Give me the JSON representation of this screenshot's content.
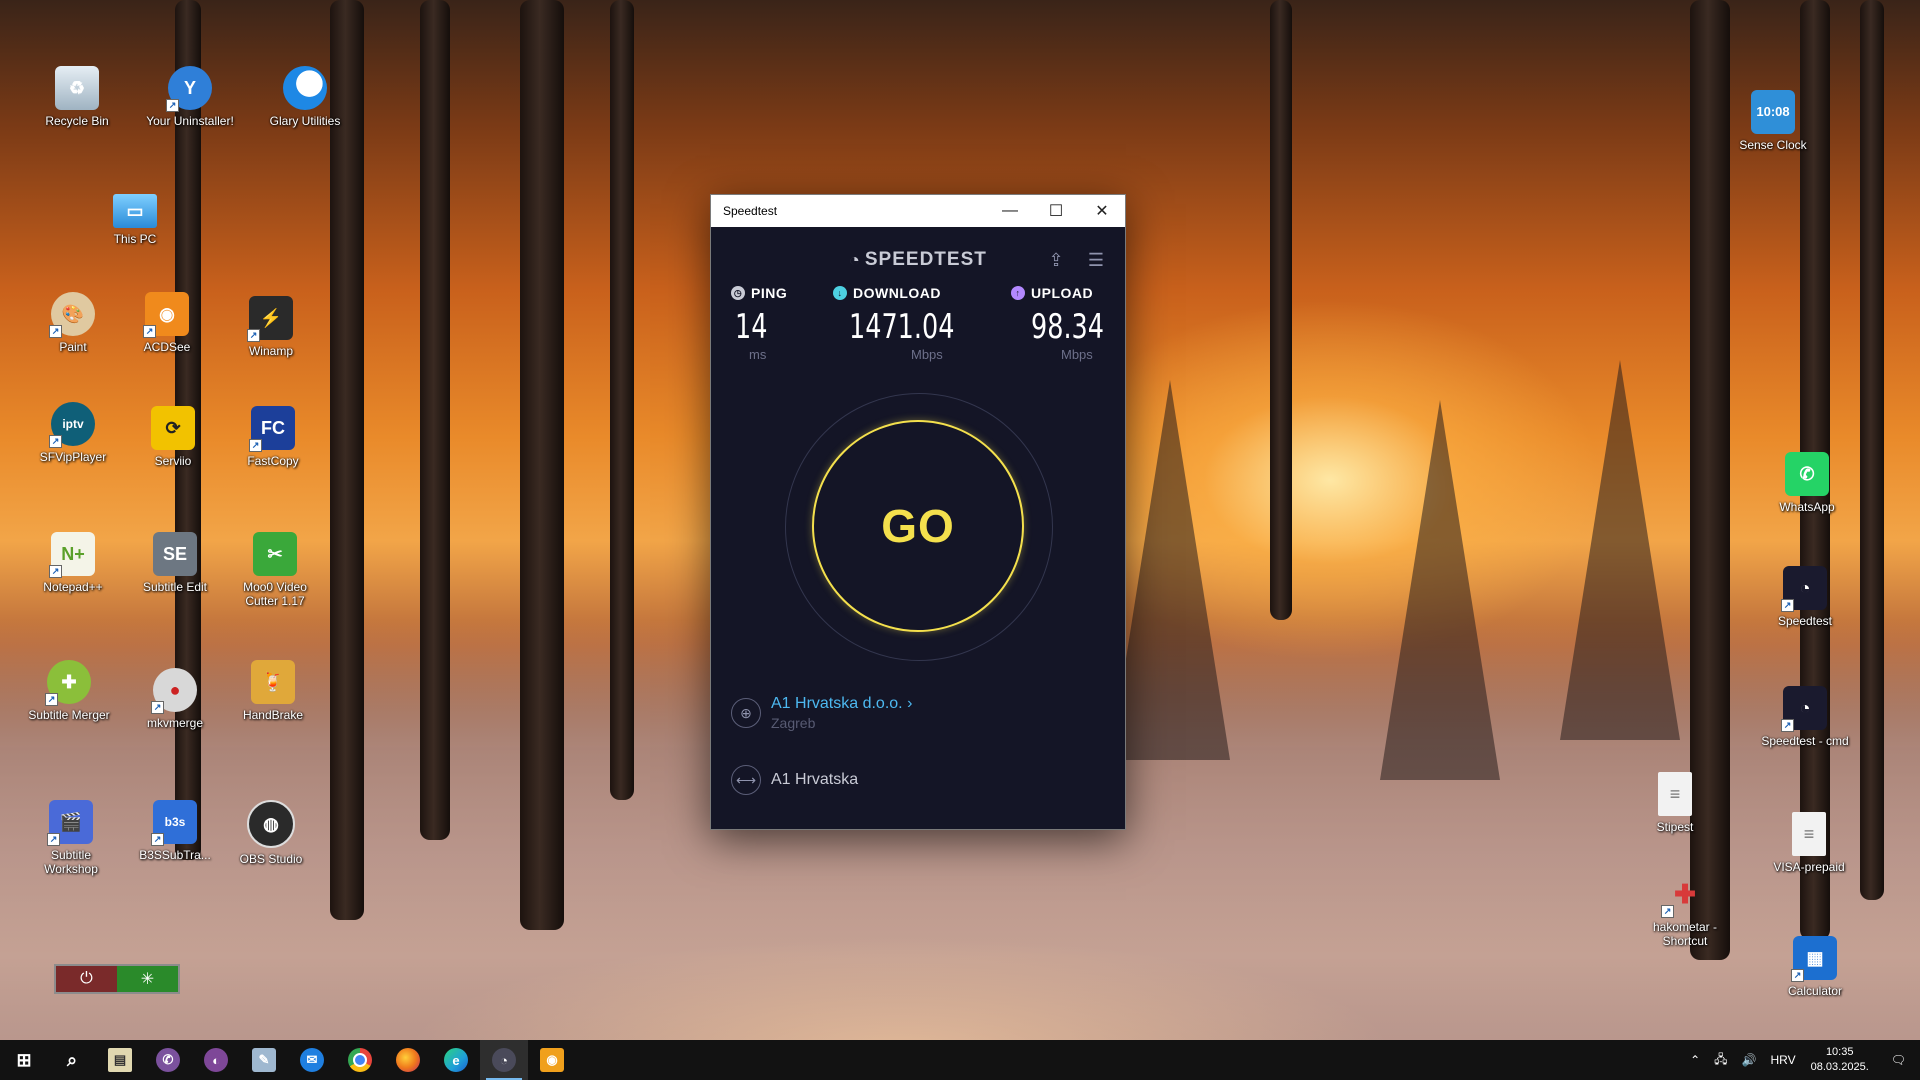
{
  "desktop_icons": [
    {
      "label": "Recycle Bin",
      "icon": "recycle-bin-icon",
      "color": "#c7d4de"
    },
    {
      "label": "Your Uninstaller!",
      "icon": "uninstaller-icon",
      "color": "#2f7fd8"
    },
    {
      "label": "Glary Utilities",
      "icon": "glary-utilities-icon",
      "color": "#1e88e5"
    },
    {
      "label": "This PC",
      "icon": "computer-icon",
      "color": "#3aa0e8"
    },
    {
      "label": "Paint",
      "icon": "paint-palette-icon",
      "color": "#e0c9a0"
    },
    {
      "label": "ACDSee",
      "icon": "acdsee-icon",
      "color": "#f08a1c"
    },
    {
      "label": "Winamp",
      "icon": "winamp-icon",
      "color": "#e8a21c"
    },
    {
      "label": "SFVipPlayer",
      "icon": "iptv-player-icon",
      "color": "#1b9bb8"
    },
    {
      "label": "Serviio",
      "icon": "serviio-icon",
      "color": "#f2c200"
    },
    {
      "label": "FastCopy",
      "icon": "fastcopy-icon",
      "color": "#1c3f9a"
    },
    {
      "label": "Notepad++",
      "icon": "notepad-plus-plus-icon",
      "color": "#7bbd3b"
    },
    {
      "label": "Subtitle Edit",
      "icon": "subtitle-edit-icon",
      "color": "#6d7782"
    },
    {
      "label": "Moo0 Video Cutter 1.17",
      "icon": "video-cutter-icon",
      "color": "#3aa83a"
    },
    {
      "label": "Subtitle Merger",
      "icon": "subtitle-merger-icon",
      "color": "#8bbf3a"
    },
    {
      "label": "mkvmerge",
      "icon": "mkvmerge-icon",
      "color": "#d8d8d8"
    },
    {
      "label": "HandBrake",
      "icon": "handbrake-icon",
      "color": "#e0a83a"
    },
    {
      "label": "Subtitle Workshop",
      "icon": "subtitle-workshop-icon",
      "color": "#4a6ad8"
    },
    {
      "label": "B3SSubTra...",
      "icon": "b3s-subtitle-icon",
      "color": "#2f6fd8"
    },
    {
      "label": "OBS Studio",
      "icon": "obs-studio-icon",
      "color": "#2a2a2a"
    },
    {
      "label": "Sense Clock",
      "icon": "sense-clock-icon",
      "color": "#2f8fd8"
    },
    {
      "label": "WhatsApp",
      "icon": "whatsapp-icon",
      "color": "#25d366"
    },
    {
      "label": "Speedtest",
      "icon": "speedtest-icon",
      "color": "#1a1a2e"
    },
    {
      "label": "Speedtest - cmd",
      "icon": "speedtest-cmd-icon",
      "color": "#1a1a2e"
    },
    {
      "label": "Stipest",
      "icon": "text-file-icon",
      "color": "#f2f2f2"
    },
    {
      "label": "VISA-prepaid",
      "icon": "text-file-icon",
      "color": "#f2f2f2"
    },
    {
      "label": "hakometar - Shortcut",
      "icon": "hakometar-icon",
      "color": "#d83a3a"
    },
    {
      "label": "Calculator",
      "icon": "calculator-icon",
      "color": "#1c6fd0"
    }
  ],
  "sense_clock_time": "10:08",
  "window": {
    "title": "Speedtest",
    "minimize": "—",
    "maximize": "☐",
    "close": "✕"
  },
  "speedtest": {
    "logo": "SPEEDTEST",
    "ping": {
      "label": "PING",
      "value": "14",
      "unit": "ms",
      "color": "#c9cbd6"
    },
    "download": {
      "label": "DOWNLOAD",
      "value": "1471.04",
      "unit": "Mbps",
      "color": "#4dd0e1"
    },
    "upload": {
      "label": "UPLOAD",
      "value": "98.34",
      "unit": "Mbps",
      "color": "#b388ff"
    },
    "go_label": "GO",
    "go_color": "#f4e04d",
    "isp": {
      "name": "A1 Hrvatska d.o.o.",
      "city": "Zagreb"
    },
    "host": "A1 Hrvatska"
  },
  "taskbar": {
    "items": [
      {
        "name": "start",
        "icon": "windows-start-icon",
        "color": "#ffffff"
      },
      {
        "name": "search",
        "icon": "search-icon",
        "color": "#ffffff"
      },
      {
        "name": "task-view",
        "icon": "task-view-icon",
        "color": "#e0d8b0"
      },
      {
        "name": "viber",
        "icon": "viber-icon",
        "color": "#7b519d"
      },
      {
        "name": "tor",
        "icon": "tor-browser-icon",
        "color": "#7e4798"
      },
      {
        "name": "notes",
        "icon": "notes-icon",
        "color": "#9fb8d0"
      },
      {
        "name": "thunderbird",
        "icon": "thunderbird-icon",
        "color": "#1f7fe0"
      },
      {
        "name": "chrome",
        "icon": "chrome-icon",
        "color": "#e8453c"
      },
      {
        "name": "firefox",
        "icon": "firefox-icon",
        "color": "#f07a1c"
      },
      {
        "name": "edge",
        "icon": "edge-icon",
        "color": "#1fa0d8"
      },
      {
        "name": "speedtest",
        "icon": "speedtest-icon",
        "color": "#4a4a5a"
      },
      {
        "name": "acdsee",
        "icon": "acdsee-icon",
        "color": "#f0a01c"
      }
    ],
    "language": "HRV",
    "time": "10:35",
    "date": "08.03.2025."
  }
}
